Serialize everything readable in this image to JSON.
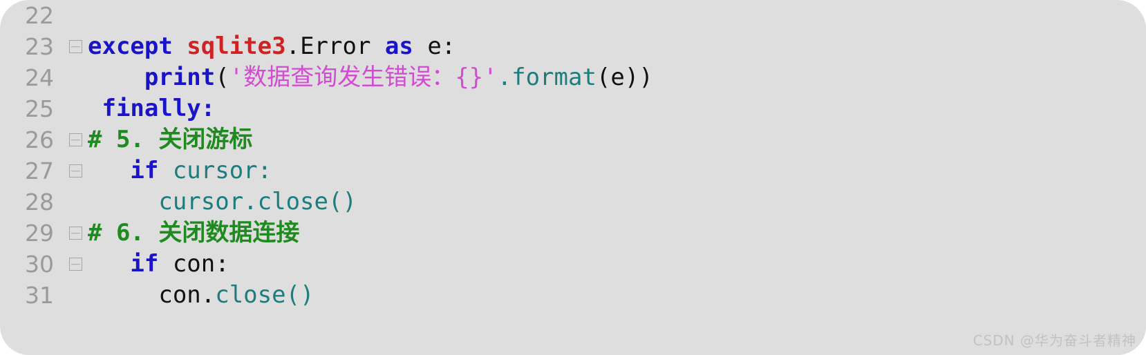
{
  "editor": {
    "background_color": "#dedede",
    "gutter_number_color": "#9a9a9a",
    "fold_marker_glyph": "minus-box",
    "first_line_number": 22,
    "last_line_number": 31,
    "language": "Python",
    "lines": [
      {
        "number": "22",
        "fold": false,
        "tokens": []
      },
      {
        "number": "23",
        "fold": true,
        "tokens": [
          {
            "text": "except ",
            "type": "keyword"
          },
          {
            "text": "sqlite3",
            "type": "module"
          },
          {
            "text": ".Error ",
            "type": "plain"
          },
          {
            "text": "as ",
            "type": "keyword"
          },
          {
            "text": "e:",
            "type": "plain"
          }
        ]
      },
      {
        "number": "24",
        "fold": false,
        "tokens": [
          {
            "text": "    print",
            "type": "keyword"
          },
          {
            "text": "(",
            "type": "plain"
          },
          {
            "text": "'数据查询发生错误：{}'",
            "type": "string"
          },
          {
            "text": ".format",
            "type": "function"
          },
          {
            "text": "(e))",
            "type": "plain"
          }
        ]
      },
      {
        "number": "25",
        "fold": false,
        "tokens": [
          {
            "text": " finally:",
            "type": "keyword"
          }
        ]
      },
      {
        "number": "26",
        "fold": true,
        "tokens": [
          {
            "text": "# 5. 关闭游标",
            "type": "comment"
          }
        ]
      },
      {
        "number": "27",
        "fold": true,
        "tokens": [
          {
            "text": "   if ",
            "type": "keyword"
          },
          {
            "text": "cursor:",
            "type": "identifier"
          }
        ]
      },
      {
        "number": "28",
        "fold": false,
        "tokens": [
          {
            "text": "     cursor.close()",
            "type": "identifier"
          }
        ]
      },
      {
        "number": "29",
        "fold": true,
        "tokens": [
          {
            "text": "# 6. 关闭数据连接",
            "type": "comment"
          }
        ]
      },
      {
        "number": "30",
        "fold": true,
        "tokens": [
          {
            "text": "   if ",
            "type": "keyword"
          },
          {
            "text": "con:",
            "type": "plain"
          }
        ]
      },
      {
        "number": "31",
        "fold": false,
        "tokens": [
          {
            "text": "     con.",
            "type": "plain"
          },
          {
            "text": "close()",
            "type": "identifier"
          }
        ]
      }
    ]
  },
  "watermark": {
    "text": "CSDN @华为奋斗者精神",
    "color": "#c2c2c2"
  },
  "palette": {
    "keyword": "#1a14c8",
    "module": "#cf2222",
    "string": "#d14cd1",
    "function": "#1d7d7d",
    "identifier": "#1d7d7d",
    "comment": "#1f8a1f",
    "plain": "#111111",
    "background": "#dedede"
  }
}
